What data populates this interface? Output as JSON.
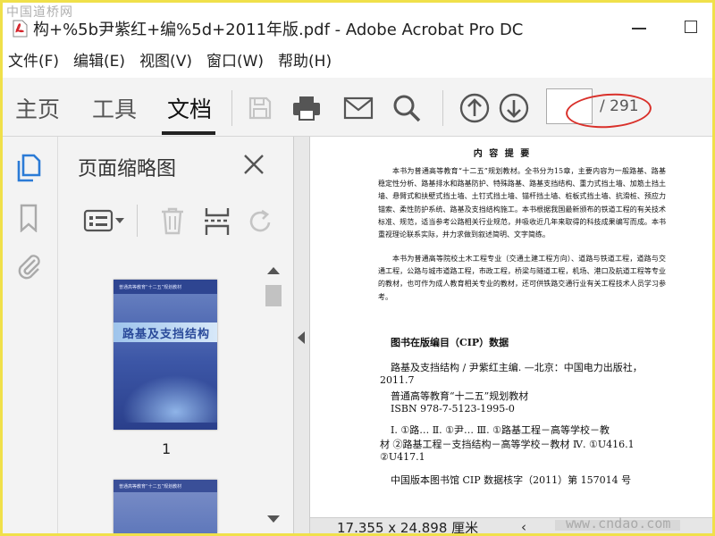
{
  "window": {
    "title": "构+%5b尹紫红+编%5d+2011年版.pdf - Adobe Acrobat Pro DC",
    "watermark_top": "中国道桥网",
    "watermark_bottom": "www.cndao.com"
  },
  "menu": [
    "文件(F)",
    "编辑(E)",
    "视图(V)",
    "窗口(W)",
    "帮助(H)"
  ],
  "toolbar": {
    "tabs": [
      {
        "label": "主页"
      },
      {
        "label": "工具"
      },
      {
        "label": "文档",
        "active": true
      }
    ],
    "icons": [
      "save-icon",
      "print-icon",
      "mail-icon",
      "search-icon",
      "prev-page-icon",
      "next-page-icon"
    ],
    "page_current": "",
    "page_total": "/ 291",
    "highlight_color": "#d9302a"
  },
  "rail": {
    "icons": [
      "page-thumbnails-icon",
      "bookmark-icon",
      "attachment-icon"
    ],
    "accent_color": "#2b7bd6"
  },
  "thumbnails_panel": {
    "title": "页面缩略图",
    "tools": [
      "options-menu-icon",
      "delete-icon",
      "insert-page-icon",
      "rotate-icon"
    ],
    "pages": [
      {
        "label": "1",
        "cover_title": "路基及支挡结构",
        "cover_header": "普通高等教育“十二五”规划教材"
      },
      {
        "label": "",
        "cover_title": "",
        "cover_header": "普通高等教育“十二五”规划教材"
      }
    ]
  },
  "document": {
    "heading": "内 容 提 要",
    "para1": "本书为普通高等教育“十二五”规划教材。全书分为15章，主要内容为一般路基、路基稳定性分析、路基排水和路基防护、特殊路基、路基支挡结构、重力式挡土墙、加筋土挡土墙、悬臂式和扶壁式挡土墙、土钉式挡土墙、锚杆挡土墙、桩板式挡土墙、抗滑桩、预应力锚索、柔性防护系统、路基及支挡结构施工。本书根据我国最新颁布的铁道工程的有关技术标准、规范，适当参考公路相关行业规范，并吸收近几年来取得的科技成果编写而成。本书重视理论联系实际，并力求做到叙述简明、文字简练。",
    "para2": "本书为普通高等院校土木工程专业（交通土建工程方向）、道路与铁道工程，道路与交通工程，公路与城市道路工程，市政工程，桥梁与隧道工程，机场、港口及航道工程等专业的教材，也可作为成人教育相关专业的教材，还可供铁路交通行业有关工程技术人员学习参考。",
    "cip_title": "图书在版编目（CIP）数据",
    "cip_lines": [
      "路基及支挡结构 / 尹紫红主编. —北京：中国电力出版社，",
      "2011.7",
      "普通高等教育“十二五”规划教材",
      "ISBN 978-7-5123-1995-0",
      "Ⅰ. ①路…   Ⅱ. ①尹…   Ⅲ. ①路基工程－高等学校－教",
      "材  ②路基工程－支挡结构－高等学校－教材   Ⅳ. ①U416.1",
      "②U417.1",
      "中国版本图书馆 CIP 数据核字（2011）第 157014 号"
    ]
  },
  "status": {
    "page_size": "17.355 x 24.898 厘米"
  }
}
